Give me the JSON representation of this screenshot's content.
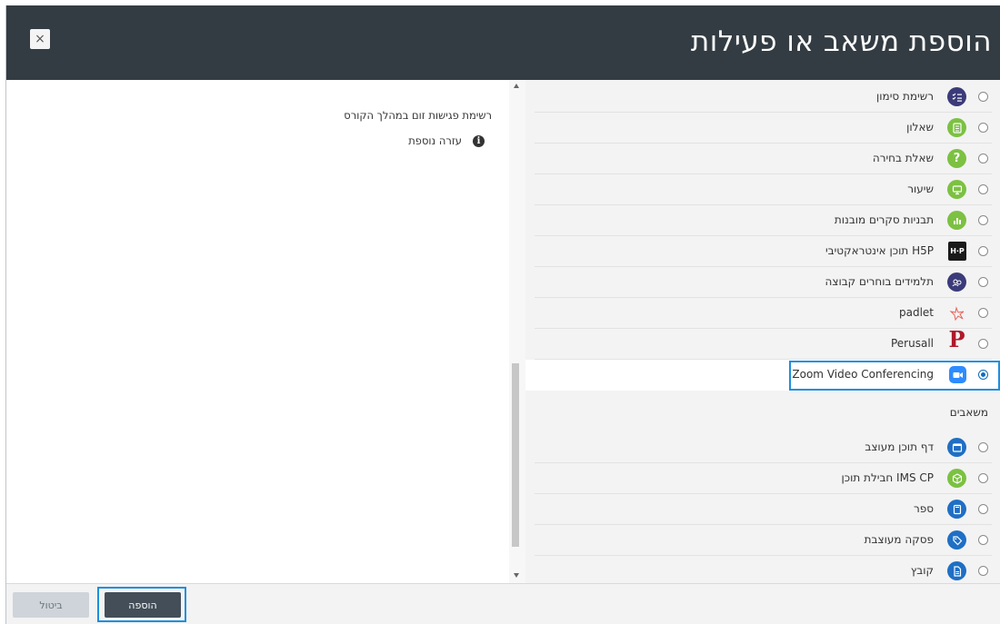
{
  "header": {
    "title": "הוספת משאב או פעילות",
    "close_label": "×"
  },
  "details": {
    "description": "רשימת פגישות זום במהלך הקורס",
    "help_label": "עזרה נוספת",
    "help_icon": "info-icon"
  },
  "activities": [
    {
      "label": "רשימת סימון",
      "icon": "checklist-icon",
      "color": "#3b3b7a"
    },
    {
      "label": "שאלון",
      "icon": "quiz-icon",
      "color": "#7cc142"
    },
    {
      "label": "שאלת בחירה",
      "icon": "question-icon",
      "color": "#7cc142"
    },
    {
      "label": "שיעור",
      "icon": "lesson-icon",
      "color": "#7cc142"
    },
    {
      "label": "תבניות סקרים מובנות",
      "icon": "survey-icon",
      "color": "#7cc142"
    },
    {
      "label": "תוכן אינטראקטיבי H5P",
      "icon": "h5p-icon",
      "color": "#1a1a1a",
      "icon_text": "H·P"
    },
    {
      "label": "תלמידים בוחרים קבוצה",
      "icon": "group-choice-icon",
      "color": "#3b3b7a"
    },
    {
      "label": "padlet",
      "icon": "padlet-icon",
      "color": "#e8605a"
    },
    {
      "label": "Perusall",
      "icon": "perusall-icon",
      "color": "#b0182a",
      "icon_text": "P"
    },
    {
      "label": "Zoom Video Conferencing",
      "icon": "zoom-icon",
      "color": "#2d8cff",
      "selected": true
    }
  ],
  "resources_heading": "משאבים",
  "resources": [
    {
      "label": "דף תוכן מעוצב",
      "icon": "page-icon",
      "color": "#1f6fc5"
    },
    {
      "label": "חבילת תוכן IMS CP",
      "icon": "ims-package-icon",
      "color": "#7cc142"
    },
    {
      "label": "ספר",
      "icon": "book-icon",
      "color": "#1f6fc5"
    },
    {
      "label": "פסקה מעוצבת",
      "icon": "label-icon",
      "color": "#1f6fc5"
    },
    {
      "label": "קובץ",
      "icon": "file-icon",
      "color": "#1f6fc5"
    },
    {
      "label": "",
      "icon": "url-icon",
      "color": "#1aa0d8"
    }
  ],
  "footer": {
    "cancel_label": "ביטול",
    "add_label": "הוספה"
  }
}
